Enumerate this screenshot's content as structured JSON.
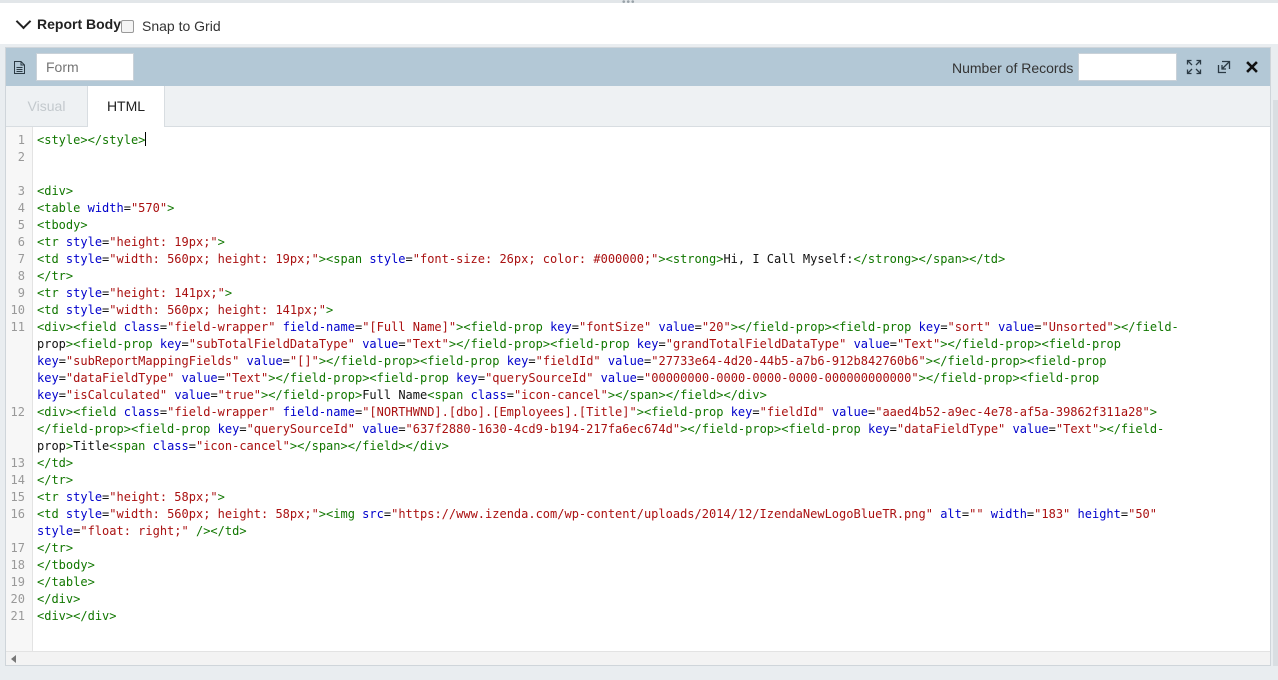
{
  "header": {
    "report_body_label": "Report Body",
    "snap_to_grid_label": "Snap to Grid",
    "snap_checked": false
  },
  "toolbar": {
    "form_placeholder": "Form",
    "number_of_records_label": "Number of Records",
    "number_of_records_value": "",
    "icons": [
      "document-icon",
      "expand-icon",
      "popout-icon",
      "close-icon"
    ]
  },
  "tabs": [
    {
      "label": "Visual",
      "active": false
    },
    {
      "label": "HTML",
      "active": true
    }
  ],
  "editor": {
    "line_numbers": [
      "1",
      "2",
      "3",
      "4",
      "5",
      "6",
      "7",
      "8",
      "9",
      "10",
      "11",
      "12",
      "13",
      "14",
      "15",
      "16",
      "17",
      "18",
      "19",
      "20",
      "21"
    ],
    "rows": [
      "<style></style>",
      "",
      "",
      "<div>",
      "<table width=\"570\">",
      "<tbody>",
      "<tr style=\"height: 19px;\">",
      "<td style=\"width: 560px; height: 19px;\"><span style=\"font-size: 26px; color: #000000;\"><strong>Hi, I Call Myself:</strong></span></td>",
      "</tr>",
      "<tr style=\"height: 141px;\">",
      "<td style=\"width: 560px; height: 141px;\">",
      "<div><field class=\"field-wrapper\" field-name=\"[Full Name]\"><field-prop key=\"fontSize\" value=\"20\"></field-prop><field-prop key=\"sort\" value=\"Unsorted\"></field-",
      "prop><field-prop key=\"subTotalFieldDataType\" value=\"Text\"></field-prop><field-prop key=\"grandTotalFieldDataType\" value=\"Text\"></field-prop><field-prop",
      "key=\"subReportMappingFields\" value=\"[]\"></field-prop><field-prop key=\"fieldId\" value=\"27733e64-4d20-44b5-a7b6-912b842760b6\"></field-prop><field-prop",
      "key=\"dataFieldType\" value=\"Text\"></field-prop><field-prop key=\"querySourceId\" value=\"00000000-0000-0000-0000-000000000000\"></field-prop><field-prop",
      "key=\"isCalculated\" value=\"true\"></field-prop>Full Name<span class=\"icon-cancel\"></span></field></div>",
      "<div><field class=\"field-wrapper\" field-name=\"[NORTHWND].[dbo].[Employees].[Title]\"><field-prop key=\"fieldId\" value=\"aaed4b52-a9ec-4e78-af5a-39862f311a28\">",
      "</field-prop><field-prop key=\"querySourceId\" value=\"637f2880-1630-4cd9-b194-217fa6ec674d\"></field-prop><field-prop key=\"dataFieldType\" value=\"Text\"></field-",
      "prop>Title<span class=\"icon-cancel\"></span></field></div>",
      "</td>",
      "</tr>",
      "<tr style=\"height: 58px;\">",
      "<td style=\"width: 560px; height: 58px;\"><img src=\"https://www.izenda.com/wp-content/uploads/2014/12/IzendaNewLogoBlueTR.png\" alt=\"\" width=\"183\" height=\"50\"",
      "style=\"float: right;\" /></td>",
      "</tr>",
      "</tbody>",
      "</table>",
      "</div>",
      "<div></div>"
    ],
    "row_line": [
      1,
      2,
      null,
      3,
      4,
      5,
      6,
      7,
      8,
      9,
      10,
      11,
      null,
      null,
      null,
      null,
      12,
      null,
      null,
      13,
      14,
      15,
      16,
      null,
      17,
      18,
      19,
      20,
      21
    ]
  },
  "colors": {
    "toolbar_bg": "#b3c8d6",
    "tag": "#117700",
    "attribute": "#0000cc",
    "string": "#aa1111"
  }
}
